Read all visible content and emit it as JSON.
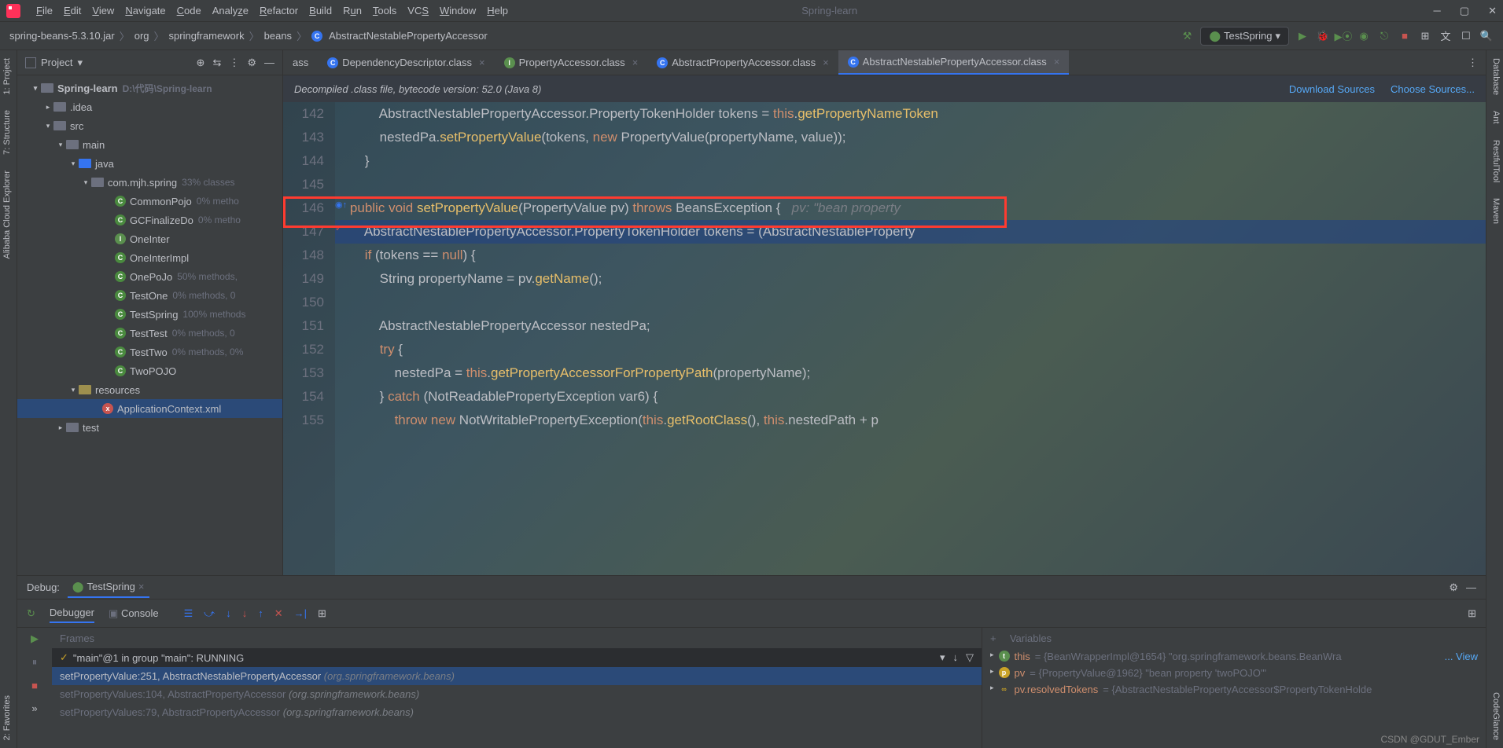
{
  "app_title": "Spring-learn",
  "menu": [
    "File",
    "Edit",
    "View",
    "Navigate",
    "Code",
    "Analyze",
    "Refactor",
    "Build",
    "Run",
    "Tools",
    "VCS",
    "Window",
    "Help"
  ],
  "breadcrumbs": [
    "spring-beans-5.3.10.jar",
    "org",
    "springframework",
    "beans",
    "AbstractNestablePropertyAccessor"
  ],
  "run_config": "TestSpring",
  "left_tabs": [
    "1: Project",
    "7: Structure",
    "Alibaba Cloud Explorer",
    "2: Favorites"
  ],
  "right_tabs": [
    "Database",
    "Ant",
    "RestfulTool",
    "Maven",
    "CodeGlance"
  ],
  "project_panel_title": "Project",
  "tree": {
    "root": {
      "name": "Spring-learn",
      "path": "D:\\代码\\Spring-learn"
    },
    "idea": ".idea",
    "src": "src",
    "main": "main",
    "java": "java",
    "pkg": "com.mjh.spring",
    "pkg_meta": "33% classes",
    "classes": [
      {
        "n": "CommonPojo",
        "m": "0% metho"
      },
      {
        "n": "GCFinalizeDo",
        "m": "0% metho"
      },
      {
        "n": "OneInter",
        "m": ""
      },
      {
        "n": "OneInterImpl",
        "m": ""
      },
      {
        "n": "OnePoJo",
        "m": "50% methods,"
      },
      {
        "n": "TestOne",
        "m": "0% methods, 0"
      },
      {
        "n": "TestSpring",
        "m": "100% methods"
      },
      {
        "n": "TestTest",
        "m": "0% methods, 0"
      },
      {
        "n": "TestTwo",
        "m": "0% methods, 0%"
      },
      {
        "n": "TwoPOJO",
        "m": ""
      }
    ],
    "resources": "resources",
    "app_ctx": "ApplicationContext.xml",
    "test": "test"
  },
  "editor_tabs": [
    {
      "label": "ass",
      "active": false
    },
    {
      "label": "DependencyDescriptor.class",
      "active": false
    },
    {
      "label": "PropertyAccessor.class",
      "active": false
    },
    {
      "label": "AbstractPropertyAccessor.class",
      "active": false
    },
    {
      "label": "AbstractNestablePropertyAccessor.class",
      "active": true
    }
  ],
  "banner": {
    "text": "Decompiled .class file, bytecode version: 52.0 (Java 8)",
    "link1": "Download Sources",
    "link2": "Choose Sources..."
  },
  "code": {
    "start": 142,
    "lines": [
      "            AbstractNestablePropertyAccessor.PropertyTokenHolder tokens = this.getPropertyNameToken",
      "            nestedPa.setPropertyValue(tokens, new PropertyValue(propertyName, value));",
      "        }",
      "",
      "    public void setPropertyValue(PropertyValue pv) throws BeansException {   pv: \"bean property ",
      "        AbstractNestablePropertyAccessor.PropertyTokenHolder tokens = (AbstractNestableProperty",
      "        if (tokens == null) {",
      "            String propertyName = pv.getName();",
      "",
      "            AbstractNestablePropertyAccessor nestedPa;",
      "            try {",
      "                nestedPa = this.getPropertyAccessorForPropertyPath(propertyName);",
      "            } catch (NotReadablePropertyException var6) {",
      "                throw new NotWritablePropertyException(this.getRootClass(), this.nestedPath + p"
    ]
  },
  "debug": {
    "label": "Debug:",
    "session": "TestSpring",
    "tabs": {
      "debugger": "Debugger",
      "console": "Console"
    },
    "frames_label": "Frames",
    "thread": "\"main\"@1 in group \"main\": RUNNING",
    "frames": [
      {
        "txt": "setPropertyValue:251, AbstractNestablePropertyAccessor",
        "pkg": "(org.springframework.beans)",
        "active": true
      },
      {
        "txt": "setPropertyValues:104, AbstractPropertyAccessor",
        "pkg": "(org.springframework.beans)",
        "active": false
      },
      {
        "txt": "setPropertyValues:79, AbstractPropertyAccessor",
        "pkg": "(org.springframework.beans)",
        "active": false
      }
    ],
    "vars_label": "Variables",
    "vars": [
      {
        "icon": "t",
        "name": "this",
        "val": "= {BeanWrapperImpl@1654} \"org.springframework.beans.BeanWra",
        "view": "... View"
      },
      {
        "icon": "p",
        "name": "pv",
        "val": "= {PropertyValue@1962} \"bean property 'twoPOJO'\"",
        "view": ""
      },
      {
        "icon": "link",
        "name": "pv.resolvedTokens",
        "val": "= {AbstractNestablePropertyAccessor$PropertyTokenHolde",
        "view": ""
      }
    ]
  },
  "watermark": "CSDN @GDUT_Ember"
}
